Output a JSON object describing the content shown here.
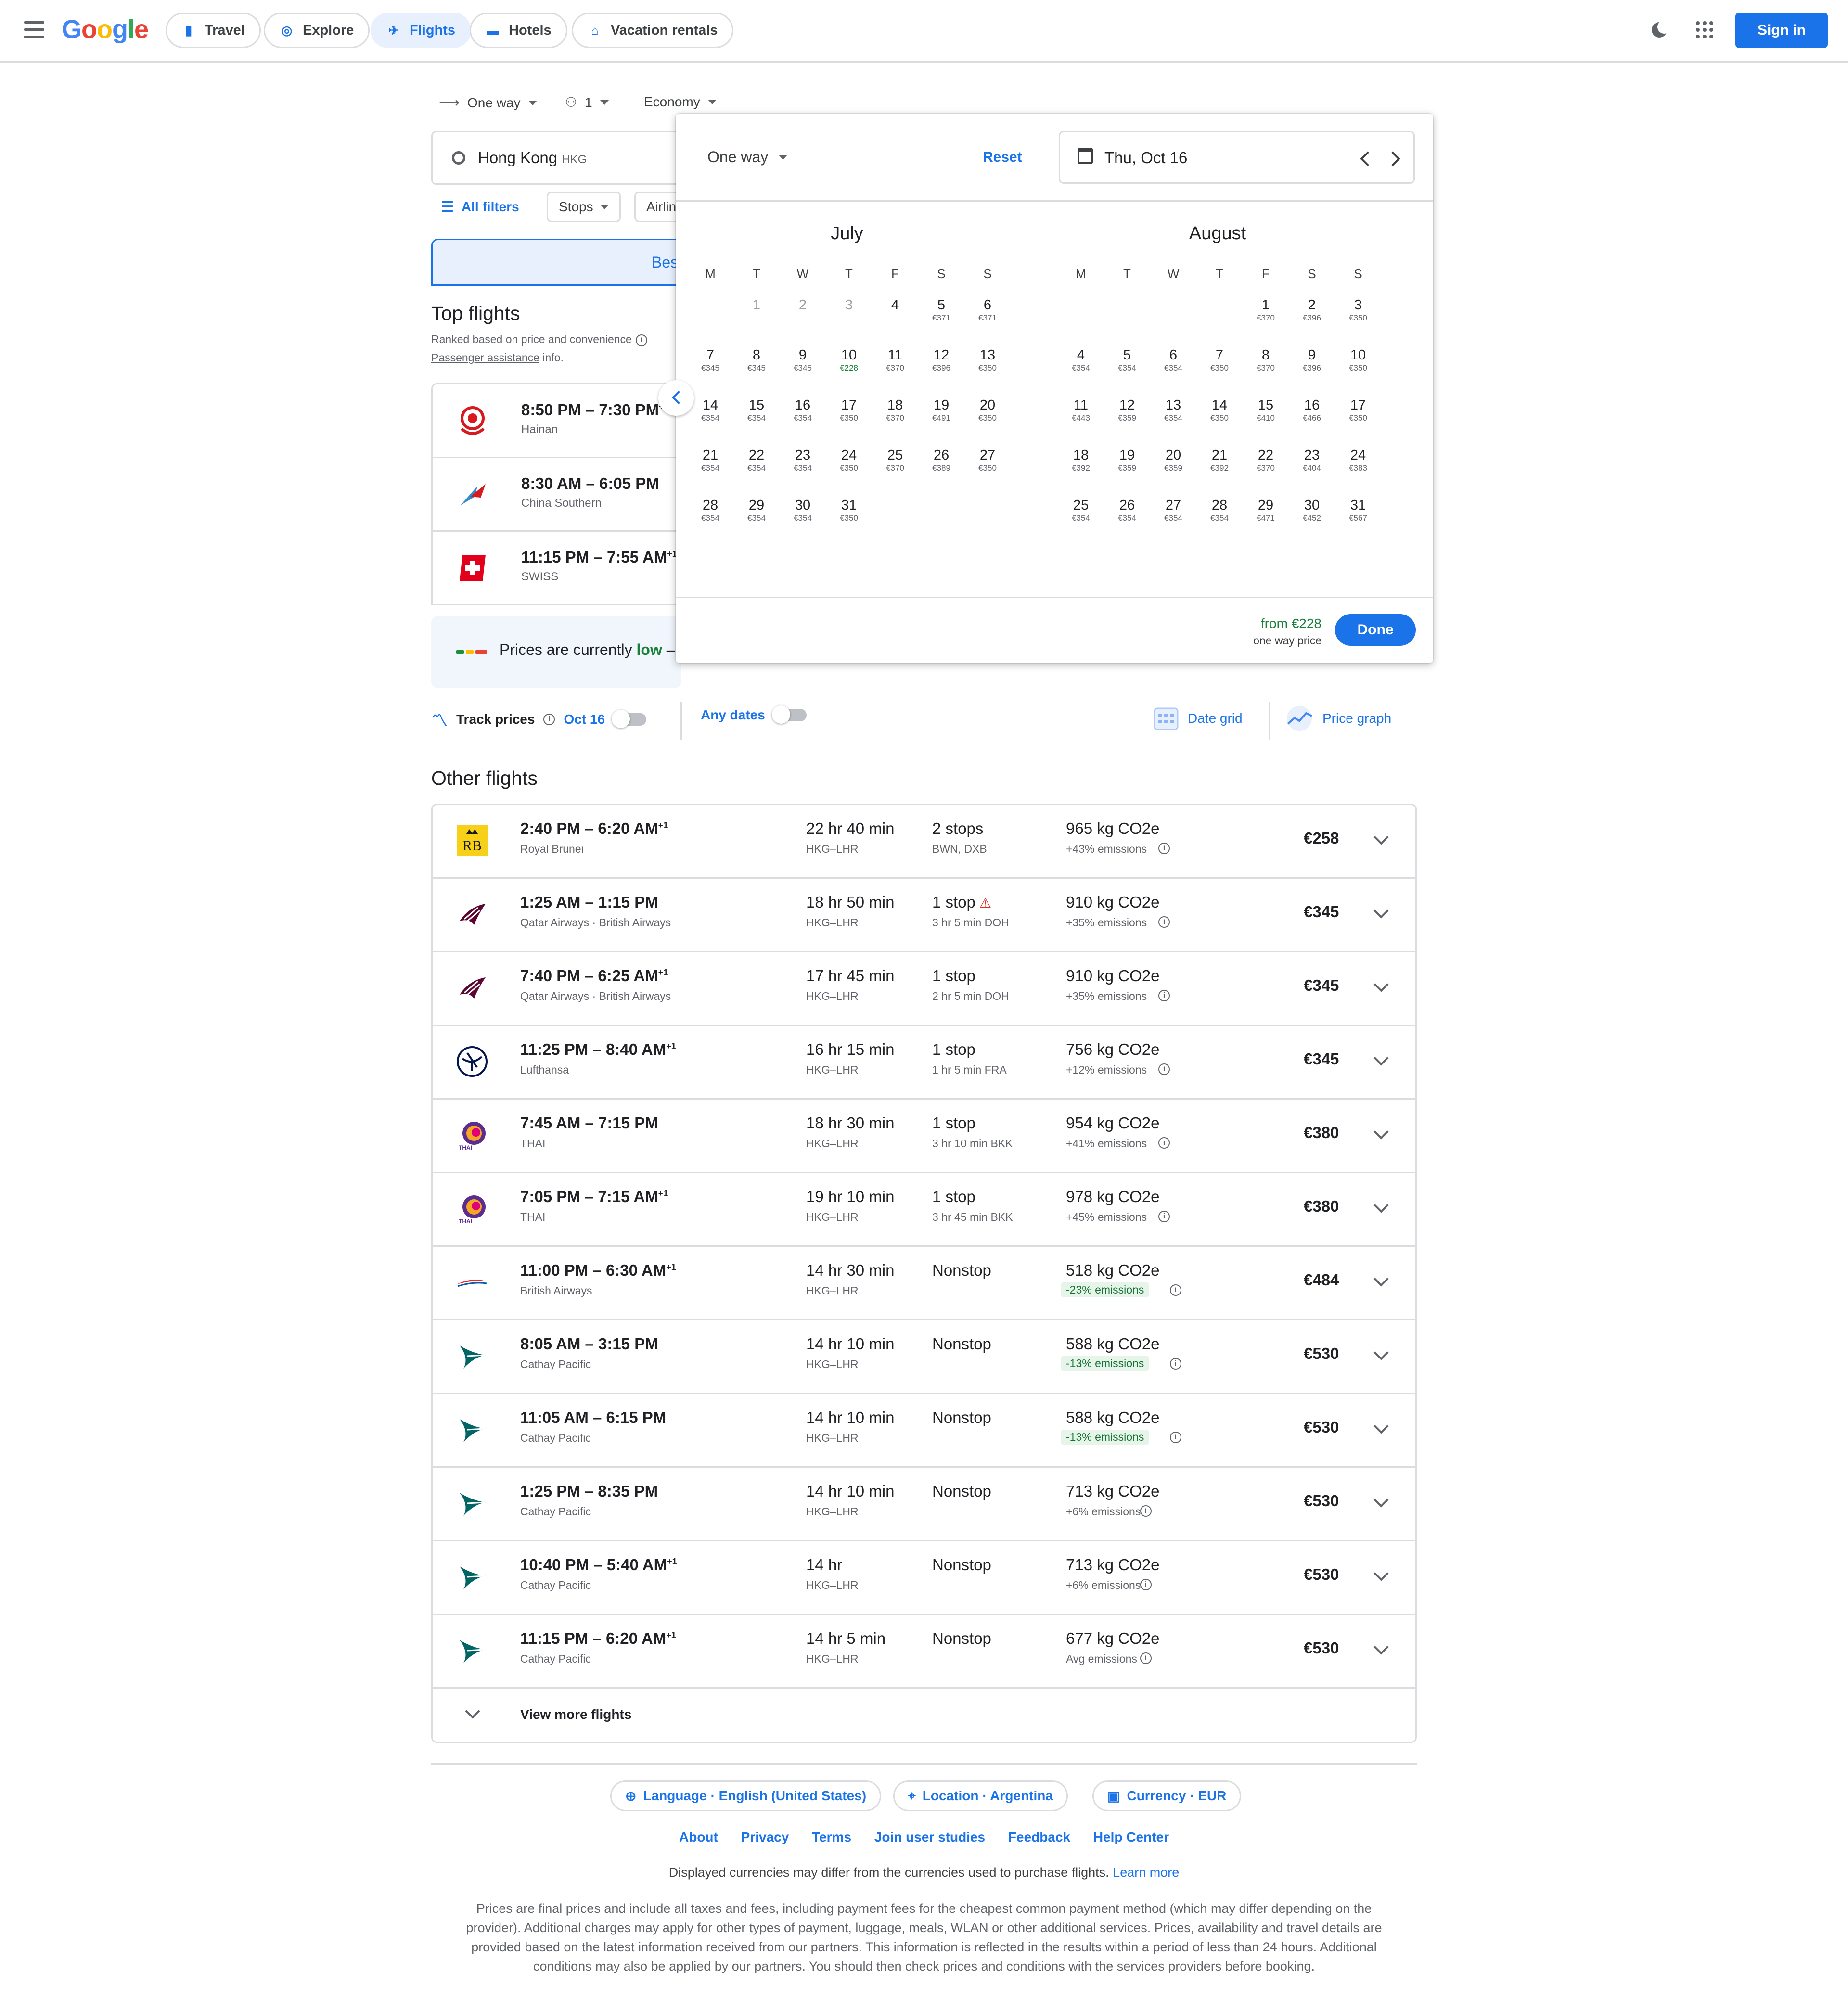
{
  "header": {
    "logo": "Google",
    "tabs": [
      {
        "label": "Travel",
        "icon": "suitcase-icon"
      },
      {
        "label": "Explore",
        "icon": "explore-icon"
      },
      {
        "label": "Flights",
        "icon": "plane-icon",
        "active": true
      },
      {
        "label": "Hotels",
        "icon": "bed-icon"
      },
      {
        "label": "Vacation rentals",
        "icon": "house-icon"
      }
    ],
    "sign_in": "Sign in"
  },
  "search": {
    "trip_type": "One way",
    "passengers": "1",
    "cabin": "Economy",
    "origin": "Hong Kong",
    "origin_code": "HKG",
    "filters": {
      "all": "All filters",
      "stops": "Stops",
      "airlines": "Airlin"
    },
    "best_tab": "Bes"
  },
  "top_flights": {
    "title": "Top flights",
    "ranked_note": "Ranked based on price and convenience",
    "assistance_link": "Passenger assistance",
    "assistance_suffix": " info.",
    "items": [
      {
        "time": "8:50 PM – 7:30 PM",
        "sup": "+",
        "airline": "Hainan"
      },
      {
        "time": "8:30 AM – 6:05 PM",
        "sup": "",
        "airline": "China Southern"
      },
      {
        "time": "11:15 PM – 7:55 AM",
        "sup": "+1",
        "airline": "SWISS"
      }
    ]
  },
  "price_banner": {
    "prefix": "Prices are currently ",
    "level": "low",
    "suffix": " –"
  },
  "track": {
    "label": "Track prices",
    "date": "Oct 16",
    "any_dates": "Any dates",
    "date_grid": "Date grid",
    "price_graph": "Price graph"
  },
  "other_flights": {
    "title": "Other flights",
    "items": [
      {
        "time": "2:40 PM – 6:20 AM",
        "sup": "+1",
        "airline": "Royal Brunei",
        "duration": "22 hr 40 min",
        "route": "HKG–LHR",
        "stops": "2 stops",
        "stop_detail": "BWN, DXB",
        "co2": "965 kg CO2e",
        "emissions": "+43% emissions",
        "price": "€258",
        "logo": "royal-brunei"
      },
      {
        "time": "1:25 AM – 1:15 PM",
        "sup": "",
        "airline": "Qatar Airways · British Airways",
        "duration": "18 hr 50 min",
        "route": "HKG–LHR",
        "stops": "1 stop",
        "stop_detail": "3 hr 5 min DOH",
        "co2": "910 kg CO2e",
        "emissions": "+35% emissions",
        "price": "€345",
        "logo": "qatar",
        "warn": true
      },
      {
        "time": "7:40 PM – 6:25 AM",
        "sup": "+1",
        "airline": "Qatar Airways · British Airways",
        "duration": "17 hr 45 min",
        "route": "HKG–LHR",
        "stops": "1 stop",
        "stop_detail": "2 hr 5 min DOH",
        "co2": "910 kg CO2e",
        "emissions": "+35% emissions",
        "price": "€345",
        "logo": "qatar"
      },
      {
        "time": "11:25 PM – 8:40 AM",
        "sup": "+1",
        "airline": "Lufthansa",
        "duration": "16 hr 15 min",
        "route": "HKG–LHR",
        "stops": "1 stop",
        "stop_detail": "1 hr 5 min FRA",
        "co2": "756 kg CO2e",
        "emissions": "+12% emissions",
        "price": "€345",
        "logo": "lufthansa"
      },
      {
        "time": "7:45 AM – 7:15 PM",
        "sup": "",
        "airline": "THAI",
        "duration": "18 hr 30 min",
        "route": "HKG–LHR",
        "stops": "1 stop",
        "stop_detail": "3 hr 10 min BKK",
        "co2": "954 kg CO2e",
        "emissions": "+41% emissions",
        "price": "€380",
        "logo": "thai"
      },
      {
        "time": "7:05 PM – 7:15 AM",
        "sup": "+1",
        "airline": "THAI",
        "duration": "19 hr 10 min",
        "route": "HKG–LHR",
        "stops": "1 stop",
        "stop_detail": "3 hr 45 min BKK",
        "co2": "978 kg CO2e",
        "emissions": "+45% emissions",
        "price": "€380",
        "logo": "thai"
      },
      {
        "time": "11:00 PM – 6:30 AM",
        "sup": "+1",
        "airline": "British Airways",
        "duration": "14 hr 30 min",
        "route": "HKG–LHR",
        "stops": "Nonstop",
        "stop_detail": "",
        "co2": "518 kg CO2e",
        "emissions": "-23% emissions",
        "good": true,
        "price": "€484",
        "logo": "ba"
      },
      {
        "time": "8:05 AM – 3:15 PM",
        "sup": "",
        "airline": "Cathay Pacific",
        "duration": "14 hr 10 min",
        "route": "HKG–LHR",
        "stops": "Nonstop",
        "stop_detail": "",
        "co2": "588 kg CO2e",
        "emissions": "-13% emissions",
        "good": true,
        "price": "€530",
        "logo": "cathay"
      },
      {
        "time": "11:05 AM – 6:15 PM",
        "sup": "",
        "airline": "Cathay Pacific",
        "duration": "14 hr 10 min",
        "route": "HKG–LHR",
        "stops": "Nonstop",
        "stop_detail": "",
        "co2": "588 kg CO2e",
        "emissions": "-13% emissions",
        "good": true,
        "price": "€530",
        "logo": "cathay"
      },
      {
        "time": "1:25 PM – 8:35 PM",
        "sup": "",
        "airline": "Cathay Pacific",
        "duration": "14 hr 10 min",
        "route": "HKG–LHR",
        "stops": "Nonstop",
        "stop_detail": "",
        "co2": "713 kg CO2e",
        "emissions": "+6% emissions",
        "price": "€530",
        "logo": "cathay"
      },
      {
        "time": "10:40 PM – 5:40 AM",
        "sup": "+1",
        "airline": "Cathay Pacific",
        "duration": "14 hr",
        "route": "HKG–LHR",
        "stops": "Nonstop",
        "stop_detail": "",
        "co2": "713 kg CO2e",
        "emissions": "+6% emissions",
        "price": "€530",
        "logo": "cathay"
      },
      {
        "time": "11:15 PM – 6:20 AM",
        "sup": "+1",
        "airline": "Cathay Pacific",
        "duration": "14 hr 5 min",
        "route": "HKG–LHR",
        "stops": "Nonstop",
        "stop_detail": "",
        "co2": "677 kg CO2e",
        "emissions": "Avg emissions",
        "price": "€530",
        "logo": "cathay"
      }
    ],
    "view_more": "View more flights"
  },
  "calendar": {
    "trip_type": "One way",
    "reset": "Reset",
    "selected_date": "Thu, Oct 16",
    "weekdays": [
      "M",
      "T",
      "W",
      "T",
      "F",
      "S",
      "S"
    ],
    "months": [
      {
        "name": "July",
        "offset": 1,
        "days": [
          {
            "d": "1",
            "p": "",
            "dis": true
          },
          {
            "d": "2",
            "p": "",
            "dis": true
          },
          {
            "d": "3",
            "p": "",
            "dis": true
          },
          {
            "d": "4",
            "p": ""
          },
          {
            "d": "5",
            "p": "€371"
          },
          {
            "d": "6",
            "p": "€371"
          },
          {
            "d": "7",
            "p": "€345"
          },
          {
            "d": "8",
            "p": "€345"
          },
          {
            "d": "9",
            "p": "€345"
          },
          {
            "d": "10",
            "p": "€228",
            "low": true
          },
          {
            "d": "11",
            "p": "€370"
          },
          {
            "d": "12",
            "p": "€396"
          },
          {
            "d": "13",
            "p": "€350"
          },
          {
            "d": "14",
            "p": "€354"
          },
          {
            "d": "15",
            "p": "€354"
          },
          {
            "d": "16",
            "p": "€354"
          },
          {
            "d": "17",
            "p": "€350"
          },
          {
            "d": "18",
            "p": "€370"
          },
          {
            "d": "19",
            "p": "€491"
          },
          {
            "d": "20",
            "p": "€350"
          },
          {
            "d": "21",
            "p": "€354"
          },
          {
            "d": "22",
            "p": "€354"
          },
          {
            "d": "23",
            "p": "€354"
          },
          {
            "d": "24",
            "p": "€350"
          },
          {
            "d": "25",
            "p": "€370"
          },
          {
            "d": "26",
            "p": "€389"
          },
          {
            "d": "27",
            "p": "€350"
          },
          {
            "d": "28",
            "p": "€354"
          },
          {
            "d": "29",
            "p": "€354"
          },
          {
            "d": "30",
            "p": "€354"
          },
          {
            "d": "31",
            "p": "€350"
          }
        ]
      },
      {
        "name": "August",
        "offset": 4,
        "days": [
          {
            "d": "1",
            "p": "€370"
          },
          {
            "d": "2",
            "p": "€396"
          },
          {
            "d": "3",
            "p": "€350"
          },
          {
            "d": "4",
            "p": "€354"
          },
          {
            "d": "5",
            "p": "€354"
          },
          {
            "d": "6",
            "p": "€354"
          },
          {
            "d": "7",
            "p": "€350"
          },
          {
            "d": "8",
            "p": "€370"
          },
          {
            "d": "9",
            "p": "€396"
          },
          {
            "d": "10",
            "p": "€350"
          },
          {
            "d": "11",
            "p": "€443"
          },
          {
            "d": "12",
            "p": "€359"
          },
          {
            "d": "13",
            "p": "€354"
          },
          {
            "d": "14",
            "p": "€350"
          },
          {
            "d": "15",
            "p": "€410"
          },
          {
            "d": "16",
            "p": "€466"
          },
          {
            "d": "17",
            "p": "€350"
          },
          {
            "d": "18",
            "p": "€392"
          },
          {
            "d": "19",
            "p": "€359"
          },
          {
            "d": "20",
            "p": "€359"
          },
          {
            "d": "21",
            "p": "€392"
          },
          {
            "d": "22",
            "p": "€370"
          },
          {
            "d": "23",
            "p": "€404"
          },
          {
            "d": "24",
            "p": "€383"
          },
          {
            "d": "25",
            "p": "€354"
          },
          {
            "d": "26",
            "p": "€354"
          },
          {
            "d": "27",
            "p": "€354"
          },
          {
            "d": "28",
            "p": "€354"
          },
          {
            "d": "29",
            "p": "€471"
          },
          {
            "d": "30",
            "p": "€452"
          },
          {
            "d": "31",
            "p": "€567"
          }
        ]
      }
    ],
    "from_price": "from €228",
    "from_sub": "one way price",
    "done": "Done"
  },
  "footer": {
    "language": "Language · English (United States)",
    "location": "Location · Argentina",
    "currency": "Currency · EUR",
    "links": [
      "About",
      "Privacy",
      "Terms",
      "Join user studies",
      "Feedback",
      "Help Center"
    ],
    "currency_note": "Displayed currencies may differ from the currencies used to purchase flights.",
    "learn_more": "Learn more",
    "disclaimer": "Prices are final prices and include all taxes and fees, including payment fees for the cheapest common payment method (which may differ depending on the provider). Additional charges may apply for other types of payment, luggage, meals, WLAN or other additional services. Prices, availability and travel details are provided based on the latest information received from our partners. This information is reflected in the results within a period of less than 24 hours. Additional conditions may also be applied by our partners. You should then check prices and conditions with the services providers before booking."
  },
  "colors": {
    "accent": "#1a73e8",
    "low_price": "#188038",
    "border": "#dadce0"
  }
}
